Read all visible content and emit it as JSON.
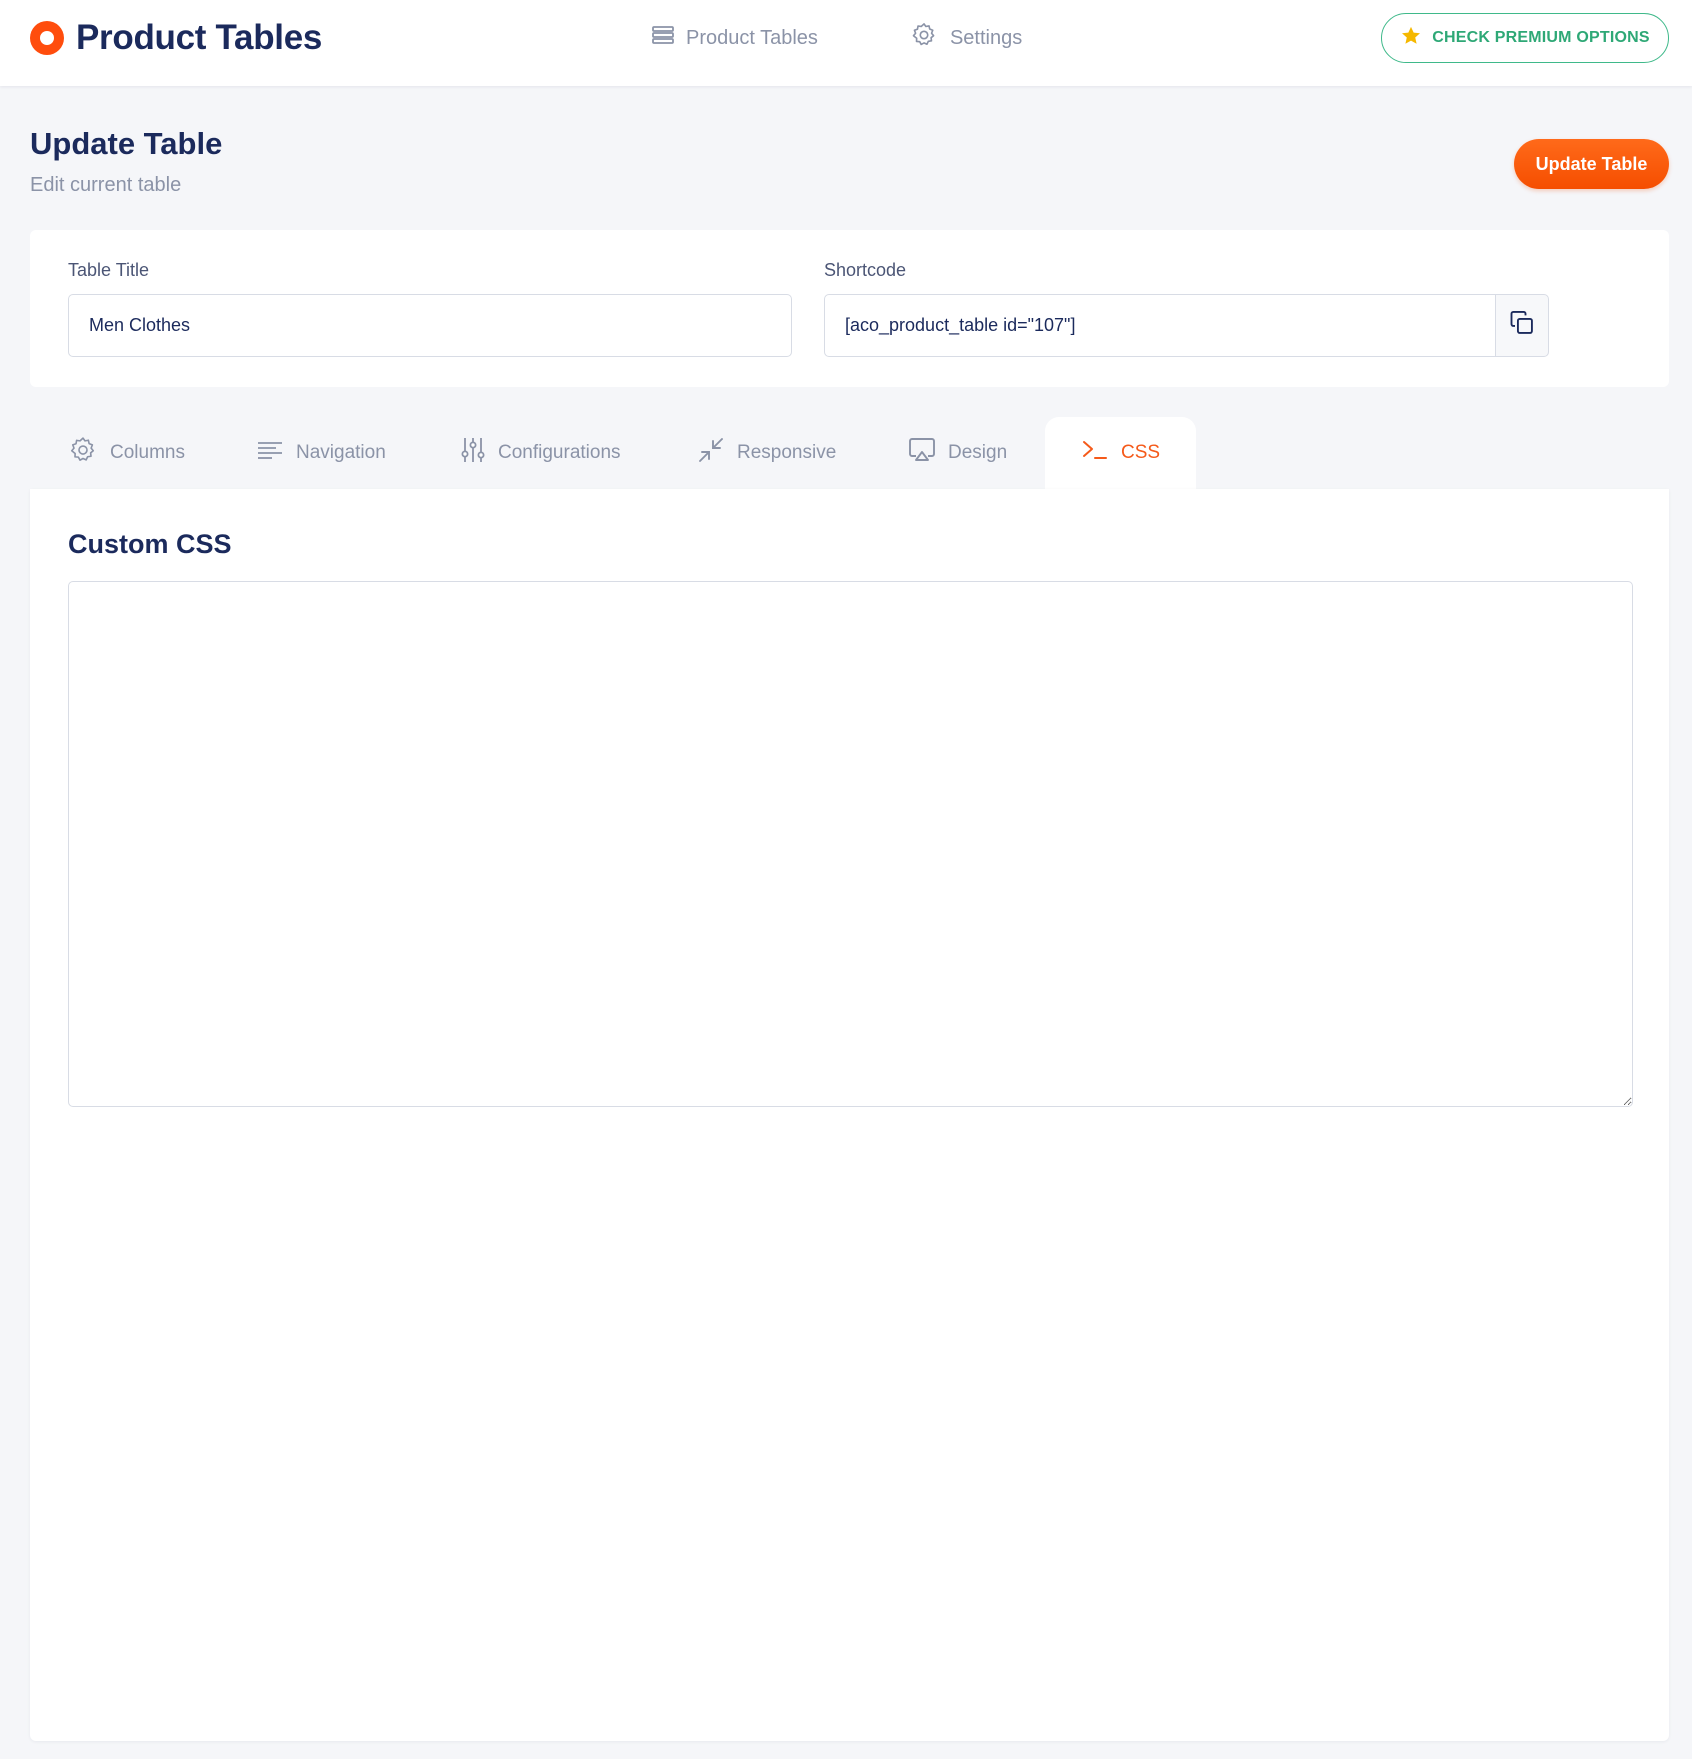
{
  "app": {
    "brand_name": "Product Tables",
    "brand_color": "#ff4d0d"
  },
  "topnav": {
    "items": [
      {
        "label": "Product Tables",
        "icon": "list-icon"
      },
      {
        "label": "Settings",
        "icon": "gear-icon"
      }
    ],
    "premium_label": "CHECK PREMIUM OPTIONS",
    "premium_icon": "star-icon",
    "premium_color": "#2ea876"
  },
  "page": {
    "title": "Update Table",
    "subtitle": "Edit current table",
    "update_button_label": "Update Table",
    "accent_color": "#f55a1a"
  },
  "form": {
    "table_title_label": "Table Title",
    "table_title_value": "Men Clothes",
    "shortcode_label": "Shortcode",
    "shortcode_value": "[aco_product_table id=\"107\"]",
    "copy_icon": "copy-icon"
  },
  "tabs": [
    {
      "label": "Columns",
      "icon": "gear-icon",
      "active": false
    },
    {
      "label": "Navigation",
      "icon": "lines-icon",
      "active": false
    },
    {
      "label": "Configurations",
      "icon": "sliders-icon",
      "active": false
    },
    {
      "label": "Responsive",
      "icon": "compress-icon",
      "active": false
    },
    {
      "label": "Design",
      "icon": "monitor-icon",
      "active": false
    },
    {
      "label": "CSS",
      "icon": "terminal-icon",
      "active": true
    }
  ],
  "css_panel": {
    "title": "Custom CSS",
    "editor_value": ""
  }
}
